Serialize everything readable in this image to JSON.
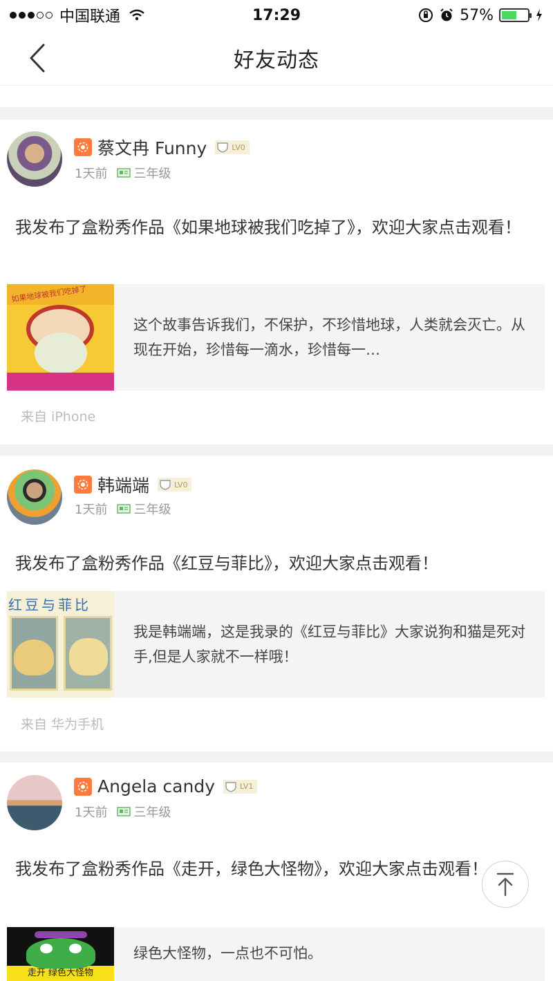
{
  "status_bar": {
    "carrier": "中国联通",
    "time": "17:29",
    "battery": "57%",
    "battery_level": 0.57
  },
  "nav": {
    "title": "好友动态",
    "back_icon": "chevron-left-icon"
  },
  "posts": [
    {
      "user_name": "蔡文冉 Funny",
      "level": "LV0",
      "time_ago": "1天前",
      "grade": "三年级",
      "text": "我发布了盒粉秀作品《如果地球被我们吃掉了》，欢迎大家点击观看！",
      "share_desc": "这个故事告诉我们，不保护，不珍惜地球，人类就会灭亡。从现在开始，珍惜每一滴水，珍惜每一…",
      "cover_title": "如果地球被我们吃掉了",
      "source": "来自 iPhone"
    },
    {
      "user_name": "韩端端",
      "level": "LV0",
      "time_ago": "1天前",
      "grade": "三年级",
      "text": "我发布了盒粉秀作品《红豆与菲比》，欢迎大家点击观看！",
      "share_desc": "我是韩端端，这是我录的《红豆与菲比》大家说狗和猫是死对手,但是人家就不一样哦！",
      "cover_title": "红豆与菲比",
      "source": "来自 华为手机"
    },
    {
      "user_name": "Angela candy",
      "level": "LV1",
      "time_ago": "1天前",
      "grade": "三年级",
      "text": "我发布了盒粉秀作品《走开，绿色大怪物》，欢迎大家点击观看！",
      "share_desc": "绿色大怪物，一点也不可怕。",
      "cover_title": "走开 绿色大怪物",
      "source": ""
    }
  ],
  "colors": {
    "accent_orange": "#ff7a3d",
    "grade_green": "#5cb85c",
    "level_bg": "#f6efd9",
    "gap_gray": "#f2f2f2"
  }
}
